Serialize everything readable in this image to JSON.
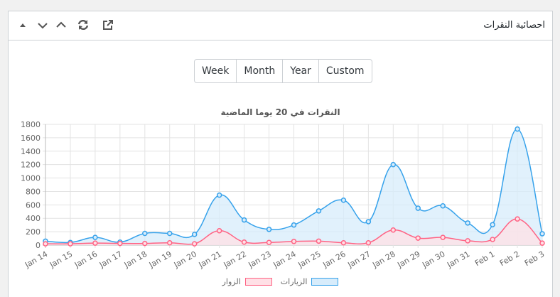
{
  "widget": {
    "title": "احصائية النقرات"
  },
  "header_icons": [
    "move-up-icon",
    "chevron-down-icon",
    "chevron-up-icon",
    "refresh-icon",
    "external-link-icon"
  ],
  "ranges": {
    "week": "Week",
    "month": "Month",
    "year": "Year",
    "custom": "Custom"
  },
  "colors": {
    "visits_line": "#36a2eb",
    "visits_fill": "#d7ecfb",
    "visitors_line": "#ff6384",
    "visitors_fill": "#ffe0e6"
  },
  "chart_data": {
    "type": "area",
    "title": "النقرات في 20 يوما الماضية",
    "categories": [
      "Jan 14",
      "Jan 15",
      "Jan 16",
      "Jan 17",
      "Jan 18",
      "Jan 19",
      "Jan 20",
      "Jan 21",
      "Jan 22",
      "Jan 23",
      "Jan 24",
      "Jan 25",
      "Jan 26",
      "Jan 27",
      "Jan 28",
      "Jan 29",
      "Jan 30",
      "Jan 31",
      "Feb 1",
      "Feb 2",
      "Feb 3"
    ],
    "ylim": [
      0,
      1800
    ],
    "yticks": [
      0,
      200,
      400,
      600,
      800,
      1000,
      1200,
      1400,
      1600,
      1800
    ],
    "grid": true,
    "legend": "bottom",
    "series": [
      {
        "name": "الزيارات",
        "values": [
          60,
          40,
          115,
          45,
          175,
          175,
          160,
          745,
          375,
          235,
          300,
          510,
          670,
          350,
          1200,
          550,
          585,
          330,
          305,
          1730,
          170
        ]
      },
      {
        "name": "الزوار",
        "values": [
          20,
          20,
          30,
          25,
          25,
          35,
          20,
          215,
          45,
          40,
          55,
          60,
          35,
          35,
          225,
          105,
          115,
          65,
          85,
          390,
          30
        ]
      }
    ]
  }
}
